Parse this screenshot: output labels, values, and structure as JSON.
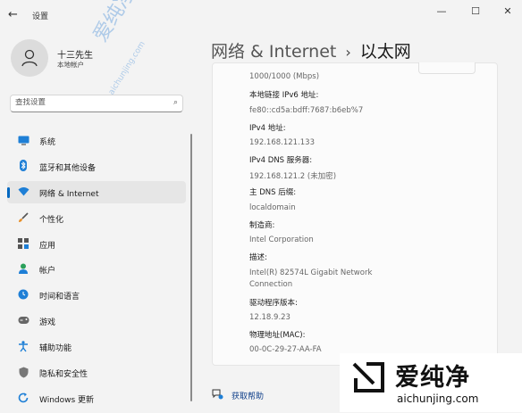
{
  "window": {
    "title": "设置"
  },
  "user": {
    "name": "十三先生",
    "subtitle": "本地帐户"
  },
  "search": {
    "placeholder": "查找设置"
  },
  "nav": [
    {
      "label": "系统",
      "icon": "monitor-icon",
      "active": false
    },
    {
      "label": "蓝牙和其他设备",
      "icon": "bluetooth-icon",
      "active": false
    },
    {
      "label": "网络 & Internet",
      "icon": "wifi-icon",
      "active": true
    },
    {
      "label": "个性化",
      "icon": "brush-icon",
      "active": false
    },
    {
      "label": "应用",
      "icon": "apps-icon",
      "active": false
    },
    {
      "label": "帐户",
      "icon": "person-icon",
      "active": false
    },
    {
      "label": "时间和语言",
      "icon": "globe-clock-icon",
      "active": false
    },
    {
      "label": "游戏",
      "icon": "gamepad-icon",
      "active": false
    },
    {
      "label": "辅助功能",
      "icon": "accessibility-icon",
      "active": false
    },
    {
      "label": "隐私和安全性",
      "icon": "shield-icon",
      "active": false
    },
    {
      "label": "Windows 更新",
      "icon": "update-icon",
      "active": false
    }
  ],
  "breadcrumb": {
    "parent": "网络 & Internet",
    "separator": "›",
    "current": "以太网"
  },
  "properties": [
    {
      "label": "",
      "value": "1000/1000 (Mbps)"
    },
    {
      "label": "本地链接 IPv6 地址:",
      "value": "fe80::cd5a:bdff:7687:b6eb%7"
    },
    {
      "label": "IPv4 地址:",
      "value": "192.168.121.133"
    },
    {
      "label": "IPv4 DNS 服务器:",
      "value": "192.168.121.2 (未加密)"
    },
    {
      "label": "主 DNS 后缀:",
      "value": "localdomain"
    },
    {
      "label": "制造商:",
      "value": "Intel Corporation"
    },
    {
      "label": "描述:",
      "value": "Intel(R) 82574L Gigabit Network",
      "value2": "Connection"
    },
    {
      "label": "驱动程序版本:",
      "value": "12.18.9.23"
    },
    {
      "label": "物理地址(MAC):",
      "value": "00-0C-29-27-AA-FA"
    }
  ],
  "help": {
    "label": "获取帮助"
  },
  "watermark": {
    "cn": "爱纯净",
    "en": "aichunjing.com"
  },
  "colors": {
    "accent": "#0067c0",
    "background": "#f3f3f3"
  }
}
